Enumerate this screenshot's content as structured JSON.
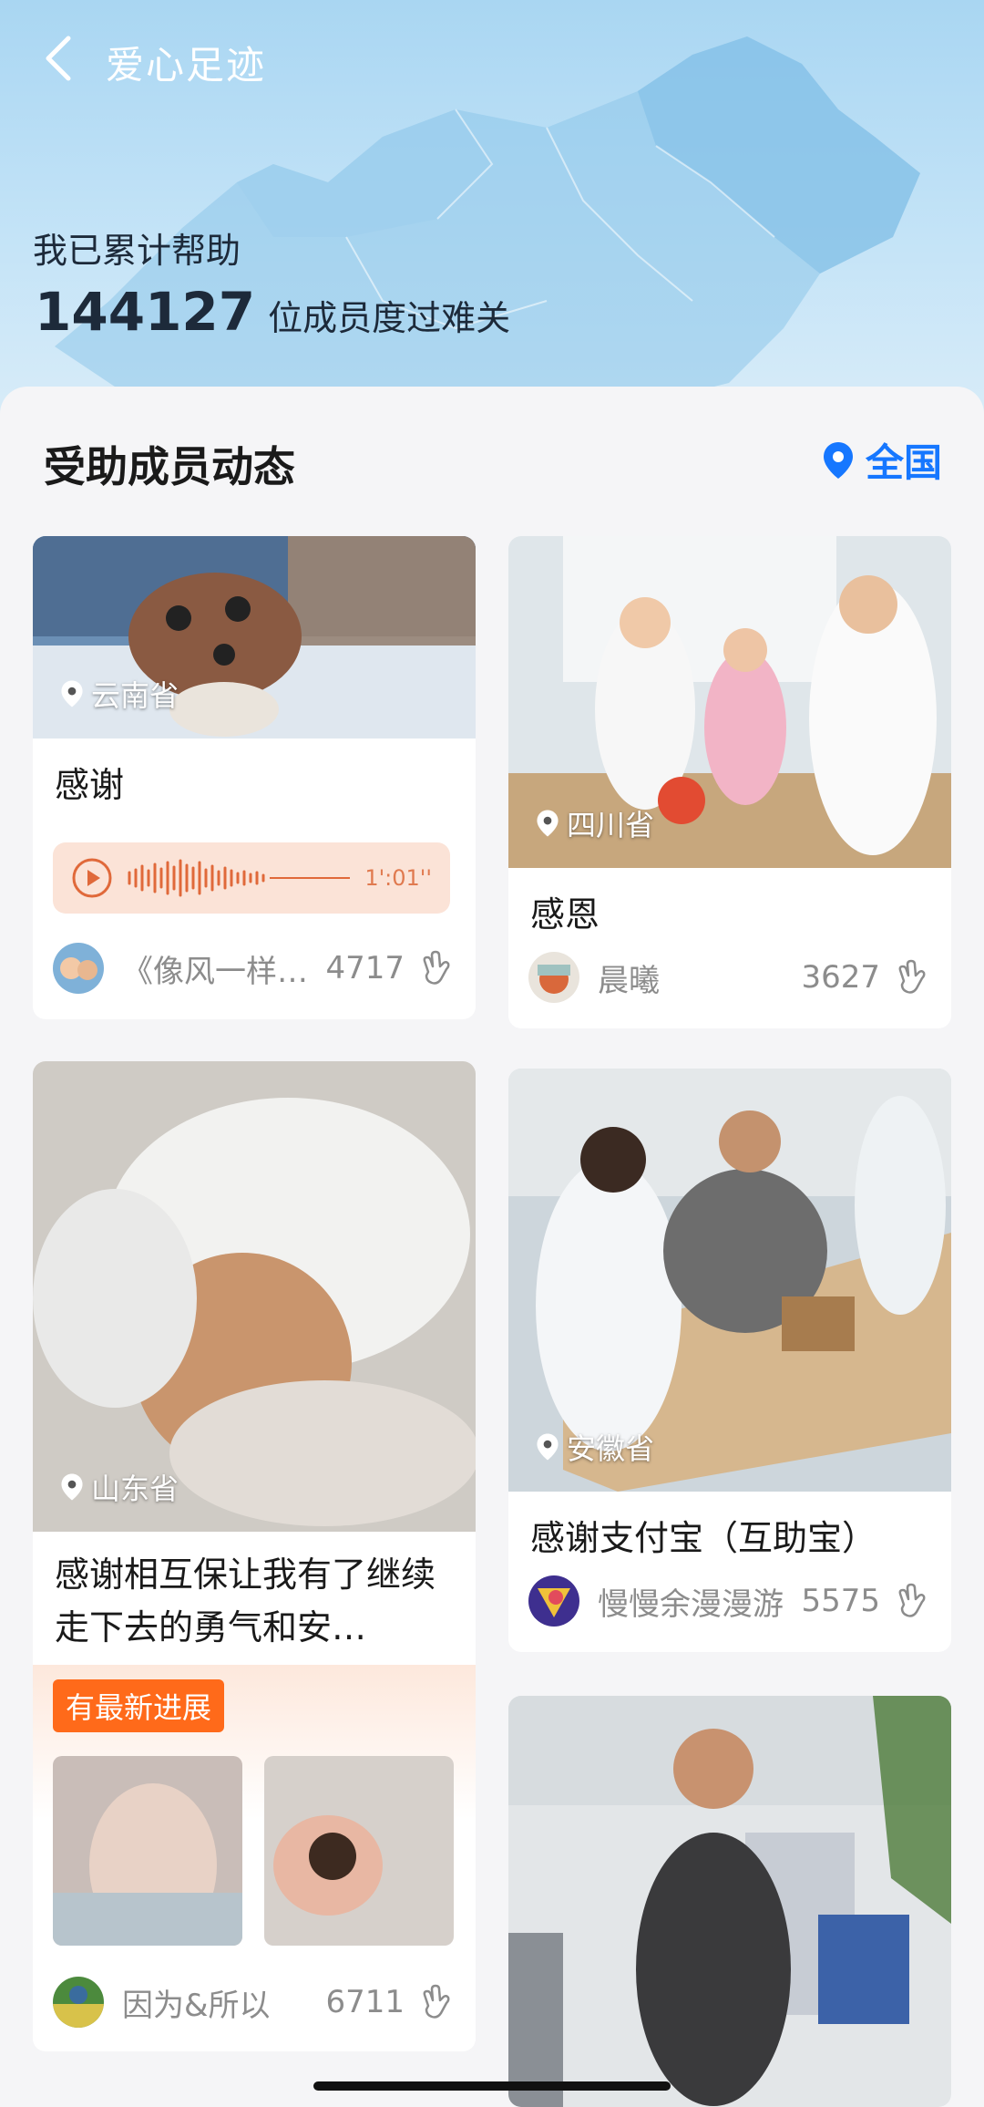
{
  "header": {
    "title": "爱心足迹",
    "help_line1": "我已累计帮助",
    "help_count": "144127",
    "help_suffix": "位成员度过难关"
  },
  "section": {
    "title": "受助成员动态",
    "region": "全国"
  },
  "cards": [
    {
      "location": "云南省",
      "title": "感谢",
      "audio_duration": "1':01''",
      "author": "《像风一样…",
      "likes": "4717"
    },
    {
      "location": "四川省",
      "title": "感恩",
      "author": "晨曦",
      "likes": "3627"
    },
    {
      "location": "山东省",
      "title": "感谢相互保让我有了继续走下去的勇气和安…",
      "badge": "有最新进展",
      "author": "因为&所以",
      "likes": "6711"
    },
    {
      "location": "安徽省",
      "title": "感谢支付宝（互助宝）",
      "author": "慢慢余漫漫游",
      "likes": "5575"
    }
  ],
  "colors": {
    "accent_blue": "#1677ff",
    "accent_orange": "#ff6a1a"
  },
  "icons": [
    "back-arrow-icon",
    "location-pin-icon",
    "play-icon",
    "heart-hand-icon"
  ]
}
